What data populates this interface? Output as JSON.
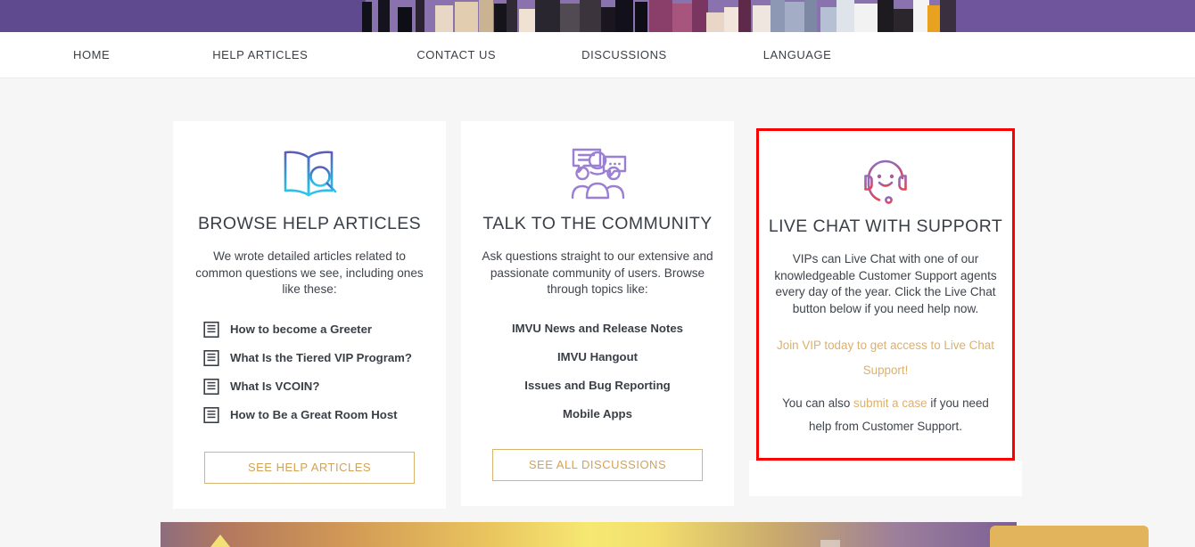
{
  "hero": {
    "alt": "imvu-avatars-banner",
    "background_color": "#6b5399"
  },
  "nav": {
    "items": [
      {
        "label": "HOME",
        "name": "nav-item-home"
      },
      {
        "label": "HELP ARTICLES",
        "name": "nav-item-help-articles"
      },
      {
        "label": "CONTACT US",
        "name": "nav-item-contact-us"
      },
      {
        "label": "DISCUSSIONS",
        "name": "nav-item-discussions"
      },
      {
        "label": "LANGUAGE",
        "name": "nav-item-language"
      }
    ]
  },
  "cards": {
    "help": {
      "icon": "book-search-icon",
      "title": "BROWSE HELP ARTICLES",
      "description": "We wrote detailed articles related to common questions we see, including ones like these:",
      "articles": [
        "How to become a Greeter",
        "What Is the Tiered VIP Program?",
        "What Is VCOIN?",
        "How to Be a Great Room Host"
      ],
      "button_label": "SEE HELP ARTICLES"
    },
    "community": {
      "icon": "community-chat-icon",
      "title": "TALK TO THE COMMUNITY",
      "description": "Ask questions straight to our extensive and passionate community of users. Browse through topics like:",
      "topics": [
        "IMVU News and Release Notes",
        "IMVU Hangout",
        "Issues and Bug Reporting",
        "Mobile Apps"
      ],
      "button_label": "SEE ALL DISCUSSIONS"
    },
    "livechat": {
      "icon": "headset-support-icon",
      "title": "LIVE CHAT WITH SUPPORT",
      "description": "VIPs can Live Chat with one of our knowledgeable Customer Support agents every day of the year. Click the Live Chat button below if you need help now.",
      "promo_link": "Join VIP today to get access to Live Chat Support!",
      "fallback_prefix": "You can also ",
      "fallback_link": "submit a case",
      "fallback_suffix": " if you need help from Customer Support.",
      "highlight_border_color": "#f90000"
    }
  },
  "bottom": {
    "banner_name": "promo-gradient-banner",
    "gold_button_name": "gold-action-button"
  },
  "colors": {
    "link_gold": "#ddb06b",
    "button_border": "#d9b471",
    "text_dark": "#3a3f47",
    "page_bg": "#f6f6f6",
    "highlight_red": "#f90000"
  }
}
